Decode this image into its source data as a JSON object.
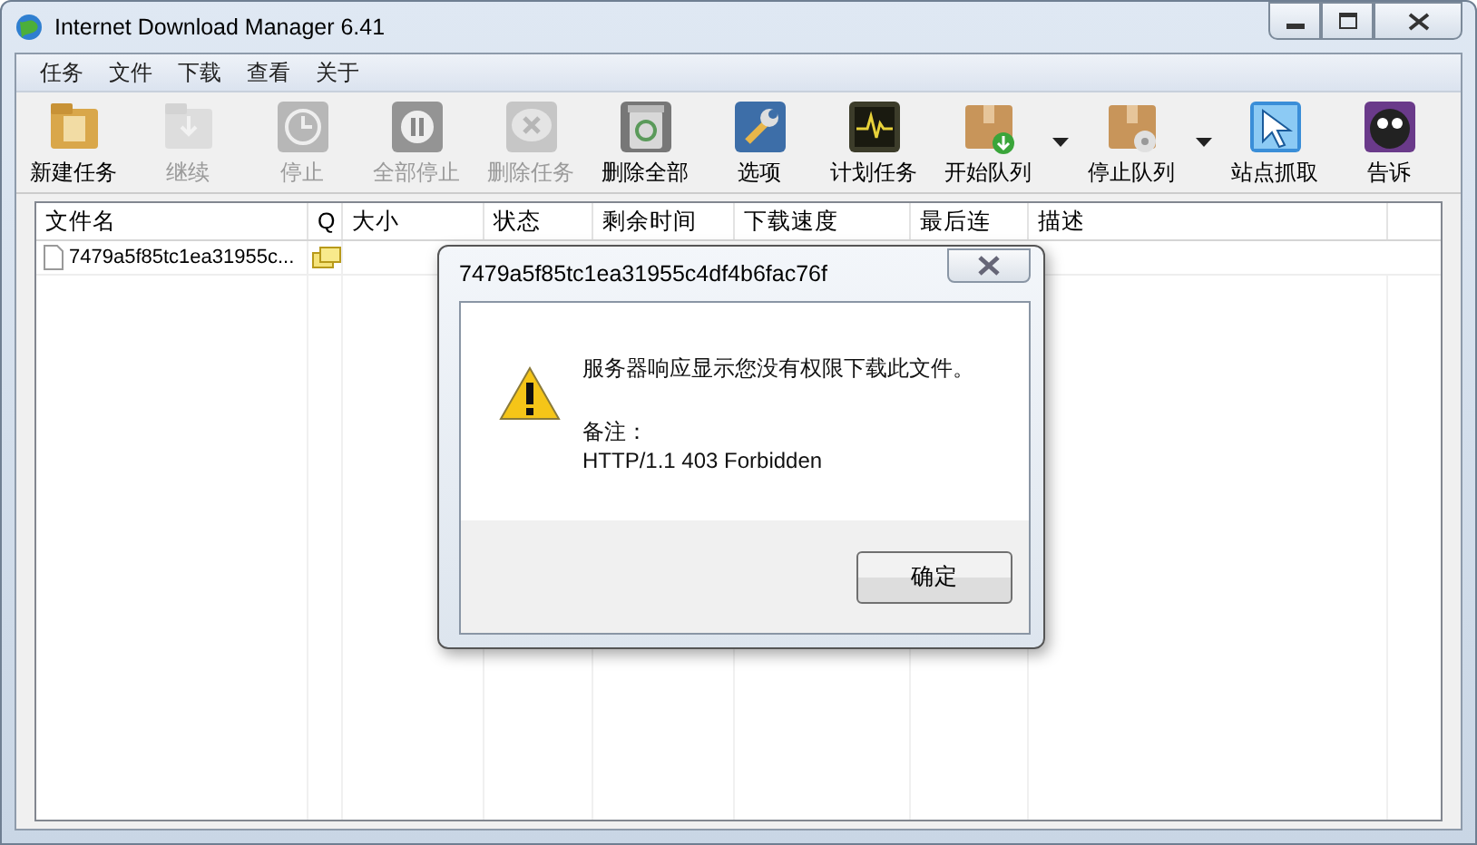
{
  "window": {
    "title": "Internet Download Manager 6.41"
  },
  "menu": [
    "任务",
    "文件",
    "下载",
    "查看",
    "关于"
  ],
  "toolbar": [
    {
      "label": "新建任务",
      "disabled": false,
      "dropdown": false
    },
    {
      "label": "继续",
      "disabled": true,
      "dropdown": false
    },
    {
      "label": "停止",
      "disabled": true,
      "dropdown": false
    },
    {
      "label": "全部停止",
      "disabled": true,
      "dropdown": false
    },
    {
      "label": "删除任务",
      "disabled": true,
      "dropdown": false
    },
    {
      "label": "删除全部",
      "disabled": false,
      "dropdown": false
    },
    {
      "label": "选项",
      "disabled": false,
      "dropdown": false
    },
    {
      "label": "计划任务",
      "disabled": false,
      "dropdown": false
    },
    {
      "label": "开始队列",
      "disabled": false,
      "dropdown": true
    },
    {
      "label": "停止队列",
      "disabled": false,
      "dropdown": true
    },
    {
      "label": "站点抓取",
      "disabled": false,
      "dropdown": false
    },
    {
      "label": "告诉",
      "disabled": false,
      "dropdown": false
    }
  ],
  "table": {
    "columns": [
      "文件名",
      "Q",
      "大小",
      "状态",
      "剩余时间",
      "下载速度",
      "最后连",
      "描述"
    ],
    "rows": [
      {
        "file_name": "7479a5f85tc1ea31955c...",
        "queued": true
      }
    ]
  },
  "dialog": {
    "title": "7479a5f85tc1ea31955c4df4b6fac76f",
    "message": "服务器响应显示您没有权限下载此文件。",
    "note_label": "备注：",
    "note": "HTTP/1.1 403 Forbidden",
    "button": "确定"
  }
}
